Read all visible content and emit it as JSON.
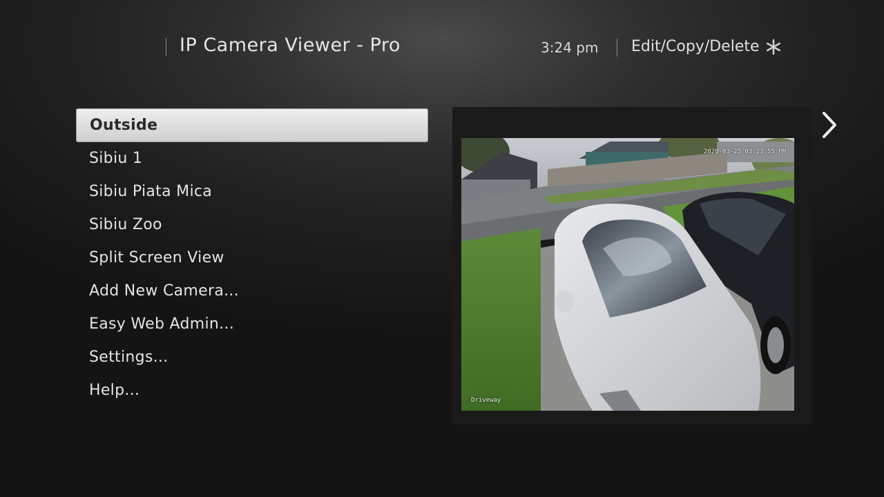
{
  "header": {
    "title": "IP Camera Viewer - Pro",
    "time": "3:24 pm",
    "options_label": "Edit/Copy/Delete",
    "options_icon": "asterisk-icon"
  },
  "menu": {
    "items": [
      {
        "label": "Outside",
        "selected": true
      },
      {
        "label": "Sibiu 1",
        "selected": false
      },
      {
        "label": "Sibiu Piata Mica",
        "selected": false
      },
      {
        "label": "Sibiu Zoo",
        "selected": false
      },
      {
        "label": "Split Screen View",
        "selected": false
      },
      {
        "label": "Add New Camera...",
        "selected": false
      },
      {
        "label": "Easy Web Admin...",
        "selected": false
      },
      {
        "label": "Settings...",
        "selected": false
      },
      {
        "label": "Help...",
        "selected": false
      }
    ]
  },
  "preview": {
    "timestamp": "2020-03-25 03:23:55 PM",
    "camera_label": "Driveway",
    "next_icon": "chevron-right-icon"
  },
  "colors": {
    "selected_bg": "#e0e0e0",
    "selected_text": "#2a2a2a",
    "text": "#e4e4e4"
  }
}
